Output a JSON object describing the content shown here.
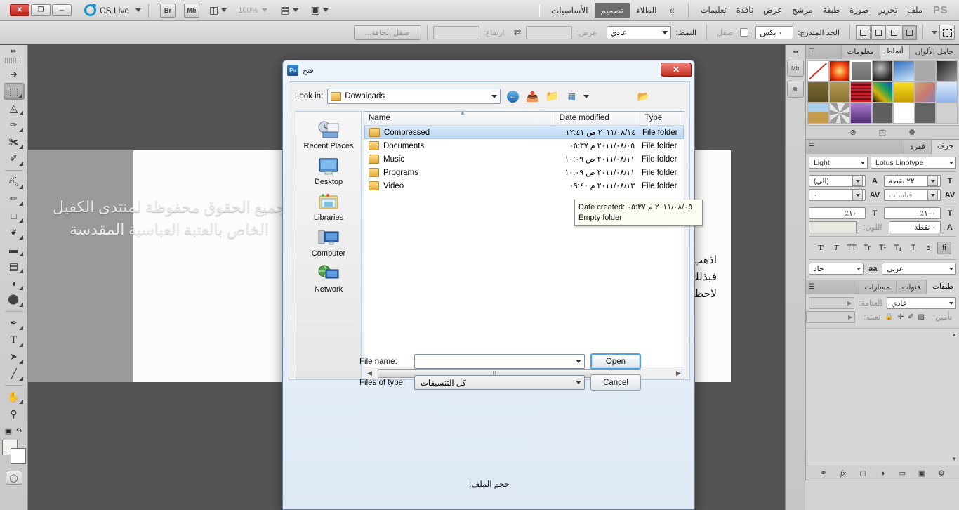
{
  "app": {
    "name": "Adobe Photoshop CS5",
    "cs_live_label": "CS Live",
    "zoom_level": "100%",
    "logo": "PS"
  },
  "window_buttons": [
    {
      "name": "close",
      "glyph": "✕"
    },
    {
      "name": "restore",
      "glyph": "❐"
    },
    {
      "name": "minimize",
      "glyph": "–"
    }
  ],
  "toolbar_top_icons": [
    {
      "name": "bridge",
      "label": "Br"
    },
    {
      "name": "mini-bridge",
      "label": "Mb"
    }
  ],
  "menu": {
    "items": [
      "ملف",
      "تحرير",
      "صورة",
      "طبقة",
      "مرشح",
      "عرض",
      "نافذة",
      "تعليمات"
    ],
    "overflow": "»",
    "workspaces": [
      {
        "label": "الطلاء",
        "selected": false
      },
      {
        "label": "تصميم",
        "selected": true
      },
      {
        "label": "الأساسيات",
        "selected": false
      }
    ]
  },
  "options_bar": {
    "refine_edge": "صقل الحافة...",
    "height_label": "ارتفاع:",
    "height_value": "",
    "width_label": "عرض:",
    "width_value": "",
    "style_label": "النمط:",
    "style_value": "عادي",
    "feather_label": "صقل",
    "gradient_label": "الحد المتدرج:",
    "gradient_value": "٠ بكس"
  },
  "tools": [
    {
      "name": "move-tool",
      "glyph": "↖",
      "selected": false,
      "has_submenu": false
    },
    {
      "name": "rectangular-marquee-tool",
      "glyph": "⬚",
      "selected": true,
      "has_submenu": true
    },
    {
      "name": "lasso-tool",
      "glyph": "⌒",
      "selected": false,
      "has_submenu": true
    },
    {
      "name": "quick-selection-tool",
      "glyph": "✎",
      "selected": false,
      "has_submenu": true
    },
    {
      "name": "crop-tool",
      "glyph": "✀",
      "selected": false,
      "has_submenu": true
    },
    {
      "name": "eyedropper-tool",
      "glyph": "✐",
      "selected": false,
      "has_submenu": true
    },
    {
      "name": "spot-healing-brush-tool",
      "glyph": "⚗",
      "selected": false,
      "has_submenu": true
    },
    {
      "name": "brush-tool",
      "glyph": "✏",
      "selected": false,
      "has_submenu": true
    },
    {
      "name": "clone-stamp-tool",
      "glyph": "⚑",
      "selected": false,
      "has_submenu": true
    },
    {
      "name": "history-brush-tool",
      "glyph": "❦",
      "selected": false,
      "has_submenu": true
    },
    {
      "name": "eraser-tool",
      "glyph": "▰",
      "selected": false,
      "has_submenu": true
    },
    {
      "name": "gradient-tool",
      "glyph": "▤",
      "selected": false,
      "has_submenu": true
    },
    {
      "name": "blur-tool",
      "glyph": "◖",
      "selected": false,
      "has_submenu": true
    },
    {
      "name": "dodge-tool",
      "glyph": "⚬",
      "selected": false,
      "has_submenu": true
    },
    {
      "name": "pen-tool",
      "glyph": "✒",
      "selected": false,
      "has_submenu": true
    },
    {
      "name": "horizontal-type-tool",
      "glyph": "T",
      "selected": false,
      "has_submenu": true
    },
    {
      "name": "path-selection-tool",
      "glyph": "➤",
      "selected": false,
      "has_submenu": true
    },
    {
      "name": "line-tool",
      "glyph": "╱",
      "selected": false,
      "has_submenu": true
    },
    {
      "name": "hand-tool",
      "glyph": "✋",
      "selected": false,
      "has_submenu": true
    },
    {
      "name": "zoom-tool",
      "glyph": "⚲",
      "selected": false,
      "has_submenu": false
    }
  ],
  "canvas": {
    "watermark_text": "جميع الحقوق محفوظة لمنتدى الكفيل الخاص بالعتبة العباسية المقدسة",
    "instruction_line1": "اذهب من ثم ذلك الى الملف الذي حملته من الانترنيت واضغط عليه",
    "instruction_line2": "فبذلك اصبحت الاشكال من ضمن البرنامج ولكيفية اخراج الاشكال",
    "instruction_line3": "لاحظ الصورة التالية"
  },
  "dialog": {
    "title": "فتح",
    "close_glyph": "✕",
    "look_in_label": "Look in:",
    "look_in_value": "Downloads",
    "nav_icons": [
      {
        "name": "back-icon",
        "glyph": "←"
      },
      {
        "name": "up-one-level-icon",
        "glyph": "↑"
      },
      {
        "name": "new-folder-icon",
        "glyph": "⊞"
      },
      {
        "name": "views-icon",
        "glyph": "☷"
      },
      {
        "name": "favorites-icon",
        "glyph": "✱"
      }
    ],
    "places": [
      {
        "name": "recent-places",
        "label": "Recent Places"
      },
      {
        "name": "desktop",
        "label": "Desktop"
      },
      {
        "name": "libraries",
        "label": "Libraries"
      },
      {
        "name": "computer",
        "label": "Computer"
      },
      {
        "name": "network",
        "label": "Network"
      }
    ],
    "columns": [
      "Name",
      "Date modified",
      "Type"
    ],
    "files": [
      {
        "name": "Compressed",
        "date": "٢٠١١/٠٨/١٤ ص ١٢:٤١",
        "type": "File folder",
        "selected": true
      },
      {
        "name": "Documents",
        "date": "٢٠١١/٠٨/٠٥ م ٠٥:٣٧",
        "type": "File folder",
        "selected": false
      },
      {
        "name": "Music",
        "date": "٢٠١١/٠٨/١١ ص ١٠:٠٩",
        "type": "File folder",
        "selected": false
      },
      {
        "name": "Programs",
        "date": "٢٠١١/٠٨/١١ ص ١٠:٠٩",
        "type": "File folder",
        "selected": false
      },
      {
        "name": "Video",
        "date": "٢٠١١/٠٨/١٣ م ٠٩:٤٠",
        "type": "File folder",
        "selected": false
      }
    ],
    "tooltip": {
      "line1": "Date created: ٢٠١١/٠٨/٠٥ م ٠٥:٣٧",
      "line2": "Empty folder"
    },
    "file_name_label": "File name:",
    "file_name_value": "",
    "files_of_type_label": "Files of type:",
    "files_of_type_value": "كل التنسيقات",
    "open_button": "Open",
    "cancel_button": "Cancel",
    "file_size_label": "حجم الملف:"
  },
  "panels": {
    "styles_group": {
      "tabs": [
        {
          "label": "معلومات",
          "active": false
        },
        {
          "label": "أنماط",
          "active": true
        },
        {
          "label": "حامل الألوان",
          "active": false
        }
      ],
      "swatches": [
        {
          "name": "none",
          "css": "#ffffff",
          "slash": true
        },
        {
          "name": "red-glow",
          "css": "radial-gradient(circle at 50% 50%, #ffe27a 0%, #f2450f 55%, #8c0e00 100%)"
        },
        {
          "name": "grey-bevel",
          "css": "linear-gradient(#8d8d8d,#6e6e6e)",
          "selected": true
        },
        {
          "name": "dark-sphere",
          "css": "radial-gradient(circle at 40% 35%, #bdbdbd, #2b2b2b 70%)"
        },
        {
          "name": "blue-sky",
          "css": "linear-gradient(160deg,#2d6fbe,#cfe6fb)"
        },
        {
          "name": "plain-grey",
          "css": "#a9a9a9"
        },
        {
          "name": "dark-fade",
          "css": "linear-gradient(135deg,#1d1d1d,#9a9a9a)"
        },
        {
          "name": "olive",
          "css": "linear-gradient(#7a6a32,#5a4d22)"
        },
        {
          "name": "gold-matte",
          "css": "linear-gradient(#b39a52,#8a7334)"
        },
        {
          "name": "red-stripes",
          "css": "repeating-linear-gradient(0deg,#c81f2d 0 3px,#6c0f18 3px 5px)"
        },
        {
          "name": "rainbow-paint",
          "css": "linear-gradient(45deg,#111,#d6b10a,#13a05a,#1f49c9)"
        },
        {
          "name": "yellow-bevel",
          "css": "linear-gradient(#f7e020,#c79d05)"
        },
        {
          "name": "sunset",
          "css": "linear-gradient(135deg,#caa77c,#c97c6e,#8a7fb5)"
        },
        {
          "name": "ice-blue",
          "css": "linear-gradient(#dce9fb,#93b6e8)"
        },
        {
          "name": "beach",
          "css": "linear-gradient(#a9cfe8 45%,#c79b4e 45%)"
        },
        {
          "name": "noise-grey",
          "css": "repeating-conic-gradient(#e7e7e7 0 8%, #9b9b9b 0 16%)"
        },
        {
          "name": "purple-box",
          "css": "linear-gradient(#b07bd6,#4d2d70)"
        },
        {
          "name": "flat-grey",
          "css": "#5f5f5f"
        },
        {
          "name": "empty-white",
          "css": "#ffffff"
        },
        {
          "name": "mid-grey",
          "css": "#646464"
        },
        {
          "name": "blank",
          "css": "#d0d0d0"
        }
      ],
      "footer_icons": [
        {
          "name": "clear-style-icon",
          "glyph": "⊘"
        },
        {
          "name": "new-style-icon",
          "glyph": "◳"
        },
        {
          "name": "delete-style-icon",
          "glyph": "Ὕ1"
        }
      ]
    },
    "character_group": {
      "tabs": [
        {
          "label": "فقرة",
          "active": false
        },
        {
          "label": "حرف",
          "active": true
        }
      ],
      "font_family": "Lotus Linotype",
      "font_style": "Light",
      "font_size_icon": "T",
      "font_size": "٢٢ نقطة",
      "leading_icon": "A",
      "leading": "(الي)",
      "kerning_icon": "AV",
      "kerning": "قياسات",
      "tracking_icon": "AV",
      "tracking": "٠",
      "vertical_scale_icon": "T",
      "vertical_scale": "١٠٠٪",
      "horizontal_scale_icon": "T",
      "horizontal_scale": "١٠٠٪",
      "baseline_icon": "A",
      "baseline": "٠ نقطة",
      "color_label": "اللون:",
      "color_value": "#e9e9e4",
      "format_buttons": [
        "fi",
        "T",
        "T",
        "T₁",
        "T¹",
        "Tr",
        "TT",
        "T",
        "T"
      ],
      "language": "عربي",
      "antialias_icon": "aa",
      "antialias": "حاد"
    },
    "layers_group": {
      "tabs": [
        {
          "label": "مسارات",
          "active": false
        },
        {
          "label": "قنوات",
          "active": false
        },
        {
          "label": "طبقات",
          "active": true
        }
      ],
      "blend_mode": "عادي",
      "opacity_label": "العتامة:",
      "opacity_value": "",
      "lock_label": "تأمين:",
      "fill_label": "تعبئة:",
      "fill_value": "",
      "lock_icons": [
        {
          "name": "lock-transparency-icon",
          "glyph": "▨"
        },
        {
          "name": "lock-image-icon",
          "glyph": "✐"
        },
        {
          "name": "lock-position-icon",
          "glyph": "✛"
        },
        {
          "name": "lock-all-icon",
          "glyph": "ὑ2"
        }
      ],
      "footer_icons": [
        {
          "name": "link-layers-icon",
          "glyph": "⚭"
        },
        {
          "name": "layer-style-icon",
          "glyph": "fx"
        },
        {
          "name": "layer-mask-icon",
          "glyph": "▢"
        },
        {
          "name": "adjustment-layer-icon",
          "glyph": "◑"
        },
        {
          "name": "new-group-icon",
          "glyph": "▱"
        },
        {
          "name": "new-layer-icon",
          "glyph": "◳"
        },
        {
          "name": "delete-layer-icon",
          "glyph": "Ὕ1"
        }
      ]
    },
    "dock_icons": [
      {
        "name": "mini-bridge-icon",
        "label": "Mb"
      },
      {
        "name": "history-icon",
        "label": "⧉"
      }
    ]
  }
}
